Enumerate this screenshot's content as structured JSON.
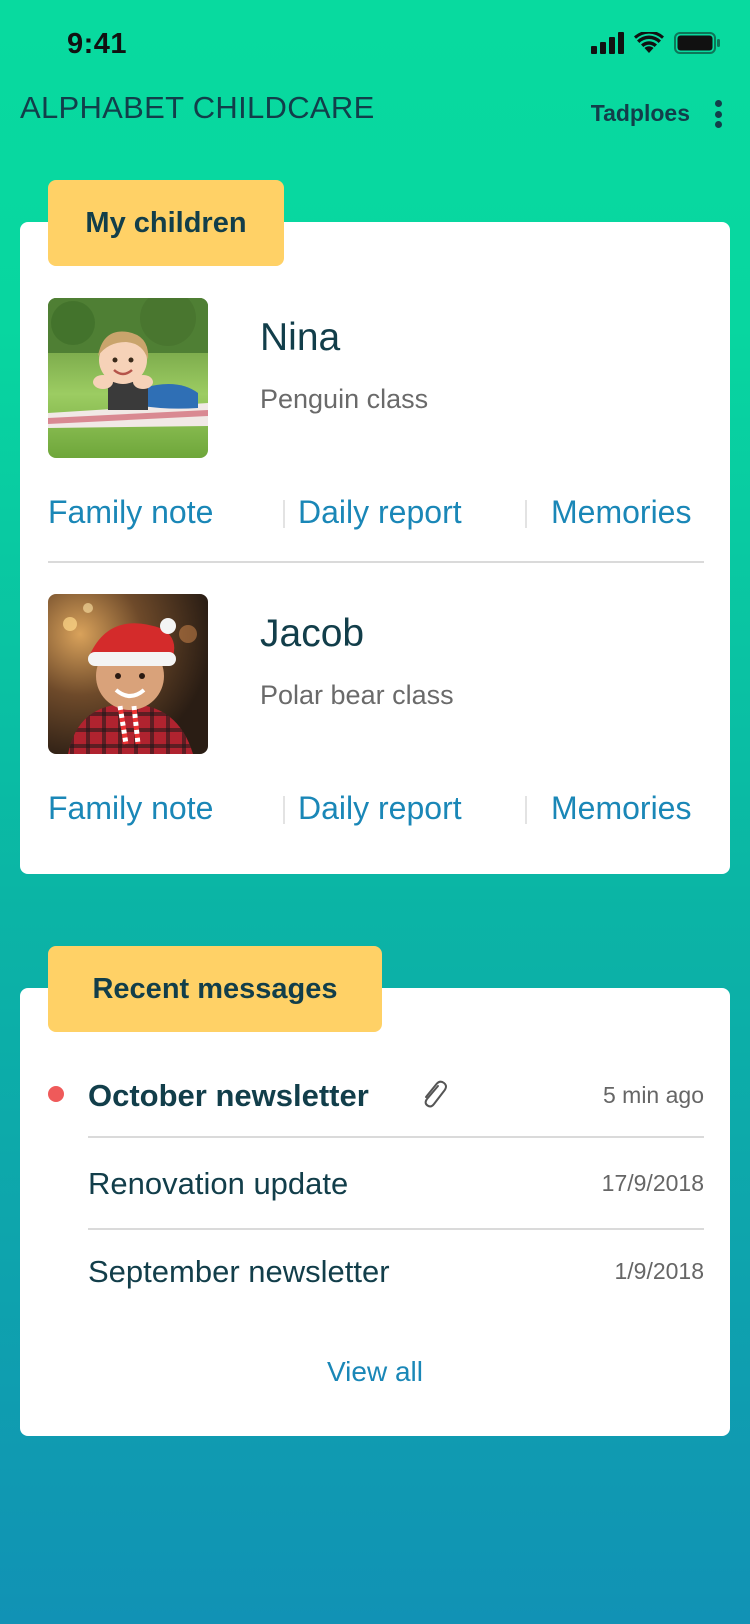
{
  "status_bar": {
    "time": "9:41"
  },
  "header": {
    "app_title": "ALPHABET CHILDCARE",
    "account_name": "Tadploes"
  },
  "children_section": {
    "label": "My children",
    "children": [
      {
        "name": "Nina",
        "class": "Penguin class",
        "links": [
          "Family note",
          "Daily report",
          "Memories"
        ]
      },
      {
        "name": "Jacob",
        "class": "Polar bear class",
        "links": [
          "Family note",
          "Daily report",
          "Memories"
        ]
      }
    ]
  },
  "messages_section": {
    "label": "Recent messages",
    "messages": [
      {
        "title": "October newsletter",
        "time": "5 min ago",
        "unread": true,
        "has_attachment": true
      },
      {
        "title": "Renovation update",
        "time": "17/9/2018",
        "unread": false,
        "has_attachment": false
      },
      {
        "title": "September newsletter",
        "time": "1/9/2018",
        "unread": false,
        "has_attachment": false
      }
    ],
    "view_all": "View all"
  },
  "colors": {
    "accent_tag": "#ffd166",
    "link": "#1a87b7",
    "unread_dot": "#ef5a5a",
    "text_dark": "#123e4a"
  },
  "icons": {
    "signal": "cellular-signal-icon",
    "wifi": "wifi-icon",
    "battery": "battery-icon",
    "more": "more-vertical-icon",
    "attachment": "paperclip-icon"
  }
}
